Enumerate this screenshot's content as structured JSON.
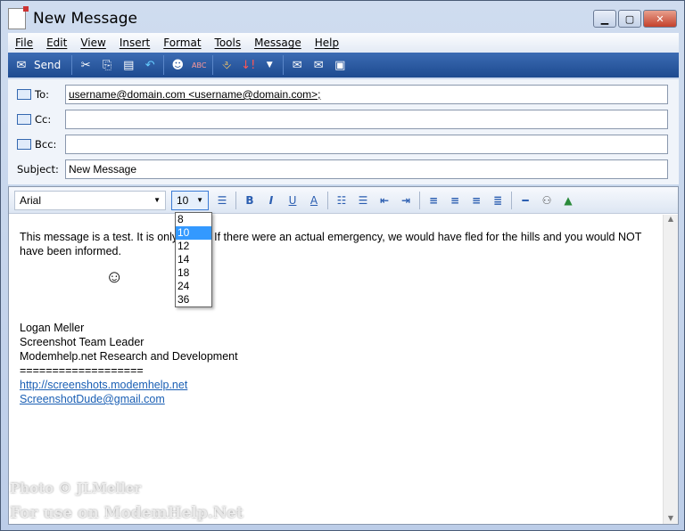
{
  "window": {
    "title": "New Message",
    "minimize": "▁",
    "maximize": "▢",
    "close": "✕"
  },
  "menu": [
    "File",
    "Edit",
    "View",
    "Insert",
    "Format",
    "Tools",
    "Message",
    "Help"
  ],
  "toolbar": {
    "send": "Send"
  },
  "fields": {
    "to_label": "To:",
    "to_value": "username@domain.com <username@domain.com>;",
    "cc_label": "Cc:",
    "cc_value": "",
    "bcc_label": "Bcc:",
    "bcc_value": "",
    "subject_label": "Subject:",
    "subject_value": "New Message"
  },
  "format": {
    "font": "Arial",
    "size": "10",
    "size_options": [
      "8",
      "10",
      "12",
      "14",
      "18",
      "24",
      "36"
    ],
    "selected_size": "10"
  },
  "body": {
    "line1": "This message is a test.  It is only a test.  If there were an actual emergency, we would have fled for the hills and you would NOT have been informed.",
    "smiley": "☺",
    "sig_name": "Logan Meller",
    "sig_title": "Screenshot Team Leader",
    "sig_org": "Modemhelp.net Research and Development",
    "sig_rule": "===================",
    "link1": "http://screenshots.modemhelp.net",
    "link2": "ScreenshotDude@gmail.com"
  },
  "watermark": {
    "line1": "Photo © JLMeller",
    "line2": "For use on ModemHelp.Net"
  }
}
